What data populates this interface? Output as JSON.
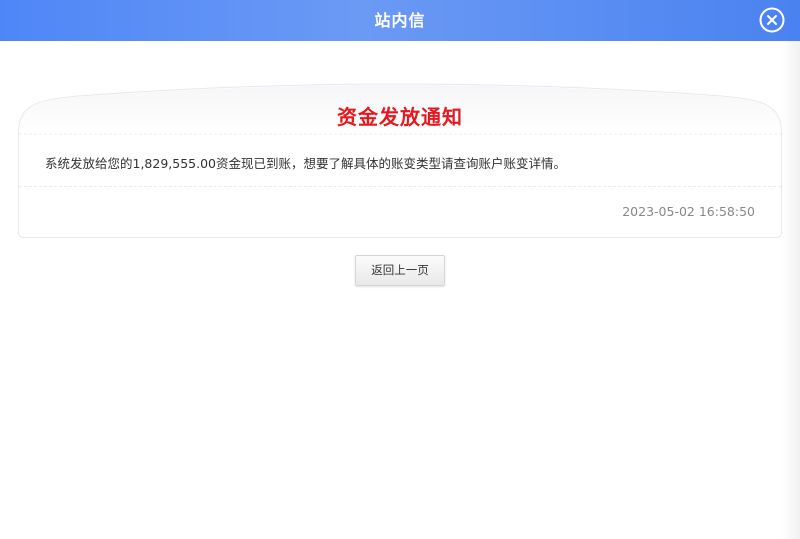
{
  "dialog": {
    "title": "站内信",
    "close_icon": "close-circle-icon"
  },
  "notice": {
    "title": "资金发放通知",
    "body": "系统发放给您的1,829,555.00资金现已到账，想要了解具体的账变类型请查询账户账变详情。",
    "time": "2023-05-02 16:58:50"
  },
  "actions": {
    "back_label": "返回上一页"
  },
  "colors": {
    "header_blue": "#4f86f7",
    "title_red": "#e6181e"
  }
}
